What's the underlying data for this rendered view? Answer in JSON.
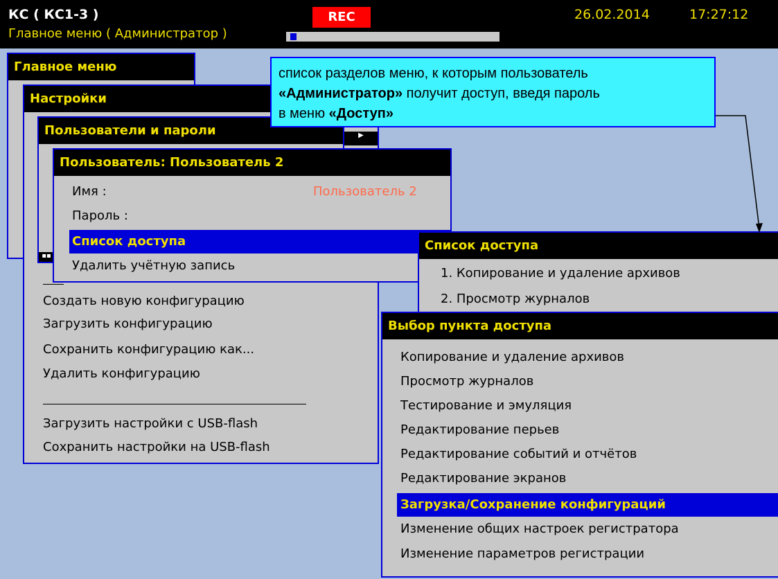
{
  "header": {
    "app_title": "КС ( КС1-3 )",
    "subtitle": "Главное меню ( Администратор )",
    "rec": "REC",
    "date": "26.02.2014",
    "time": "17:27:12",
    "progress": 0.03
  },
  "colors": {
    "background": "#a9bedc",
    "title_text": "#f0e000",
    "selection": "#0000d8",
    "rec": "#ff0000",
    "callout": "#3ff3ff",
    "value_text": "#ff6a4a"
  },
  "main_menu": {
    "title": "Главное меню"
  },
  "settings": {
    "title": "Настройки",
    "items": [
      "Создать новую конфигурацию",
      "Загрузить конфигурацию",
      "Сохранить конфигурацию как...",
      "Удалить конфигурацию",
      "Загрузить настройки с USB-flash",
      "Сохранить настройки на USB-flash"
    ]
  },
  "users": {
    "title": "Пользователи и пароли"
  },
  "user": {
    "title": "Пользователь: Пользователь 2",
    "name_label": "Имя :",
    "name_value": "Пользователь 2",
    "password_label": "Пароль :",
    "access_list": "Список доступа",
    "delete": "Удалить учётную запись"
  },
  "access_list": {
    "title": "Список доступа",
    "items": [
      "1. Копирование и удаление архивов",
      "2. Просмотр журналов"
    ]
  },
  "access_select": {
    "title": "Выбор пункта доступа",
    "items": [
      "Копирование и удаление архивов",
      "Просмотр журналов",
      "Тестирование и эмуляция",
      "Редактирование перьев",
      "Редактирование событий и отчётов",
      "Редактирование экранов",
      "Загрузка/Сохранение конфигураций",
      "Изменение общих настроек регистратора",
      "Изменение параметров регистрации"
    ],
    "selected_index": 6
  },
  "callout": {
    "line1": "список разделов меню, к которым пользователь",
    "line2_bold": "«Администратор»",
    "line2_rest": " получит доступ, введя пароль",
    "line3_pre": "в меню ",
    "line3_bold": "«Доступ»"
  }
}
